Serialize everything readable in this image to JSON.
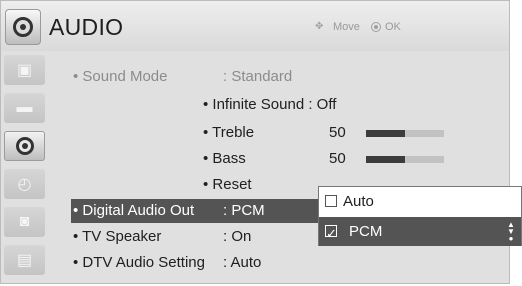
{
  "header": {
    "title": "AUDIO",
    "icon": "speaker-icon",
    "hint_move_icon": "arrow-cross-icon",
    "hint_move": "Move",
    "hint_ok_icon": "ok-circle-icon",
    "hint_ok": "OK"
  },
  "sidebar": {
    "items": [
      {
        "icon": "picture-icon",
        "glyph": "▣"
      },
      {
        "icon": "screen-icon",
        "glyph": "▬"
      },
      {
        "icon": "audio-icon",
        "glyph": ""
      },
      {
        "icon": "clock-icon",
        "glyph": "◴"
      },
      {
        "icon": "lock-icon",
        "glyph": "◙"
      },
      {
        "icon": "option-icon",
        "glyph": "▤"
      }
    ]
  },
  "menu": {
    "sound_mode": {
      "label": "• Sound Mode",
      "value": ": Standard"
    },
    "infinite_sound": {
      "label": "• Infinite Sound : Off"
    },
    "treble": {
      "label": "• Treble",
      "value": "50",
      "level": 0.5
    },
    "bass": {
      "label": "• Bass",
      "value": "50",
      "level": 0.5
    },
    "reset": {
      "label": "• Reset"
    },
    "digital_audio_out": {
      "label": "• Digital Audio Out",
      "value": ": PCM"
    },
    "tv_speaker": {
      "label": "• TV Speaker",
      "value": ": On"
    },
    "dtv_audio_setting": {
      "label": "• DTV Audio Setting",
      "value": ": Auto"
    }
  },
  "popup": {
    "options": [
      {
        "label": "Auto",
        "checked": false
      },
      {
        "label": "PCM",
        "checked": true
      }
    ],
    "scroll_icon": "scroll-updown-icon"
  }
}
